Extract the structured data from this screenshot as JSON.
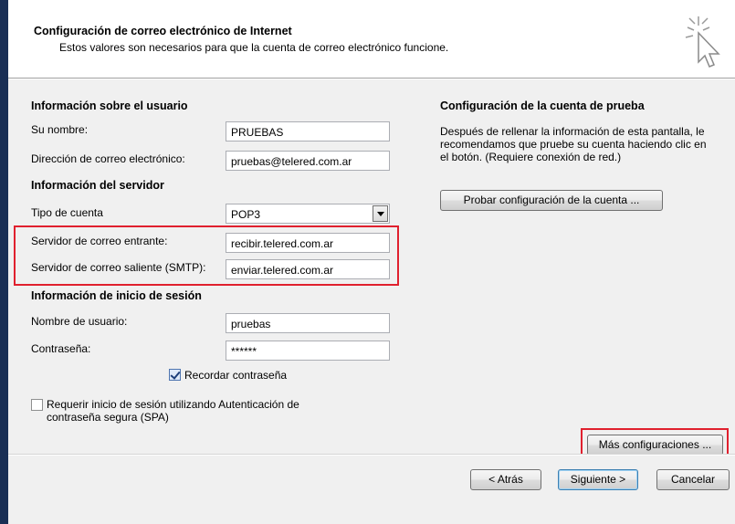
{
  "header": {
    "title": "Configuración de correo electrónico de Internet",
    "subtitle": "Estos valores son necesarios para que la cuenta de correo electrónico funcione."
  },
  "user_info": {
    "section_title": "Información sobre el usuario",
    "name_label": "Su nombre:",
    "name_value": "PRUEBAS",
    "email_label": "Dirección de correo electrónico:",
    "email_value": "pruebas@telered.com.ar"
  },
  "server_info": {
    "section_title": "Información del servidor",
    "account_type_label": "Tipo de cuenta",
    "account_type_value": "POP3",
    "incoming_label": "Servidor de correo entrante:",
    "incoming_value": "recibir.telered.com.ar",
    "outgoing_label": "Servidor de correo saliente (SMTP):",
    "outgoing_value": "enviar.telered.com.ar"
  },
  "logon_info": {
    "section_title": "Información de inicio de sesión",
    "username_label": "Nombre de usuario:",
    "username_value": "pruebas",
    "password_label": "Contraseña:",
    "password_value": "******",
    "remember_label": "Recordar contraseña",
    "remember_checked": true,
    "spa_label_line1": "Requerir inicio de sesión utilizando Autenticación de",
    "spa_label_line2": "contraseña segura (SPA)",
    "spa_checked": false
  },
  "test_settings": {
    "section_title": "Configuración de la cuenta de prueba",
    "desc_line1": "Después de rellenar la información de esta pantalla, le",
    "desc_line2": "recomendamos que pruebe su cuenta haciendo clic en",
    "desc_line3": "el botón. (Requiere conexión de red.)",
    "test_button": "Probar configuración de la cuenta ...",
    "more_settings_button": "Más configuraciones ..."
  },
  "footer": {
    "back_button": "< Atrás",
    "next_button": "Siguiente >",
    "cancel_button": "Cancelar"
  },
  "colors": {
    "highlight": "#e0202e",
    "panel_background": "#f0f0f0",
    "window_edge": "#1a2f55"
  }
}
